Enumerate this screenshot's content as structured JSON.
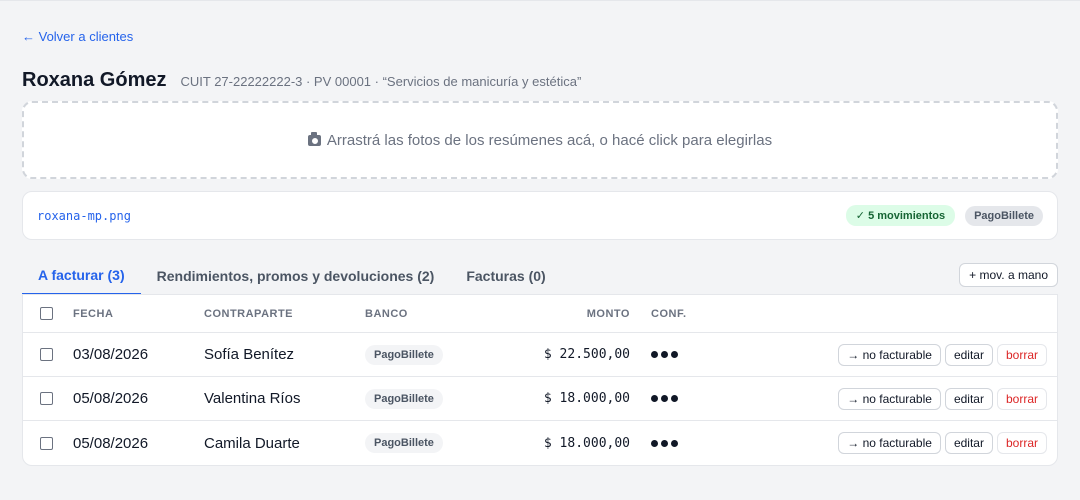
{
  "nav": {
    "back_label": "← Volver a clientes"
  },
  "client": {
    "name": "Roxana Gómez",
    "meta": "CUIT 27-22222222-3 · PV 00001 · “Servicios de manicuría y estética”"
  },
  "dropzone": {
    "label": "Arrastrá las fotos de los resúmenes acá, o hacé click para elegirlas",
    "icon": "camera-icon"
  },
  "file": {
    "name": "roxana-mp.png",
    "status_badge": "✓ 5 movimientos",
    "bank_badge": "PagoBillete"
  },
  "tabs": [
    {
      "label": "A facturar (3)",
      "active": true
    },
    {
      "label": "Rendimientos, promos y devoluciones (2)",
      "active": false
    },
    {
      "label": "Facturas (0)",
      "active": false
    }
  ],
  "add_manual_label": "+ mov. a mano",
  "table": {
    "headers": {
      "date": "FECHA",
      "counterpart": "CONTRAPARTE",
      "bank": "BANCO",
      "amount": "MONTO",
      "conf": "CONF."
    },
    "rows": [
      {
        "date": "03/08/2026",
        "counterpart": "Sofía Benítez",
        "bank": "PagoBillete",
        "amount": "$ 22.500,00"
      },
      {
        "date": "05/08/2026",
        "counterpart": "Valentina Ríos",
        "bank": "PagoBillete",
        "amount": "$ 18.000,00"
      },
      {
        "date": "05/08/2026",
        "counterpart": "Camila Duarte",
        "bank": "PagoBillete",
        "amount": "$ 18.000,00"
      }
    ],
    "actions": {
      "no_invoice": "→ no facturable",
      "edit": "editar",
      "delete": "borrar"
    }
  },
  "colors": {
    "accent": "#2563eb",
    "danger": "#dc2626",
    "success_bg": "#dcfce7",
    "success_text": "#166534"
  }
}
